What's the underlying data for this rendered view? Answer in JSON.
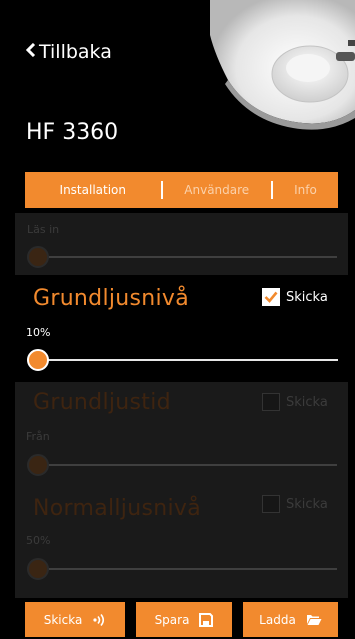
{
  "header": {
    "back_label": "Tillbaka",
    "title": "HF 3360"
  },
  "tabs": [
    {
      "label": "Installation",
      "active": true
    },
    {
      "label": "Användare",
      "active": false
    },
    {
      "label": "Info",
      "active": false
    }
  ],
  "las_in": {
    "label": "Läs in",
    "enabled": false,
    "value_fraction": 0
  },
  "grundljusniva": {
    "title": "Grundljusnivå",
    "value": "10%",
    "send_label": "Skicka",
    "send_checked": true,
    "enabled": true,
    "value_fraction": 0
  },
  "grundljustid": {
    "title": "Grundljustid",
    "value": "Från",
    "send_label": "Skicka",
    "send_checked": false,
    "enabled": false,
    "value_fraction": 0
  },
  "normalljusniva": {
    "title": "Normalljusnivå",
    "value": "50%",
    "send_label": "Skicka",
    "send_checked": false,
    "enabled": false,
    "value_fraction": 0
  },
  "bottom_buttons": {
    "send_label": "Skicka",
    "save_label": "Spara",
    "load_label": "Ladda"
  },
  "colors": {
    "accent": "#f28a2e",
    "background": "#000000",
    "dim_panel": "#1a1a1a"
  },
  "icons": {
    "back": "chevron-left-icon",
    "send": "broadcast-icon",
    "save": "floppy-disk-icon",
    "load": "folder-open-icon",
    "check": "check-icon"
  }
}
